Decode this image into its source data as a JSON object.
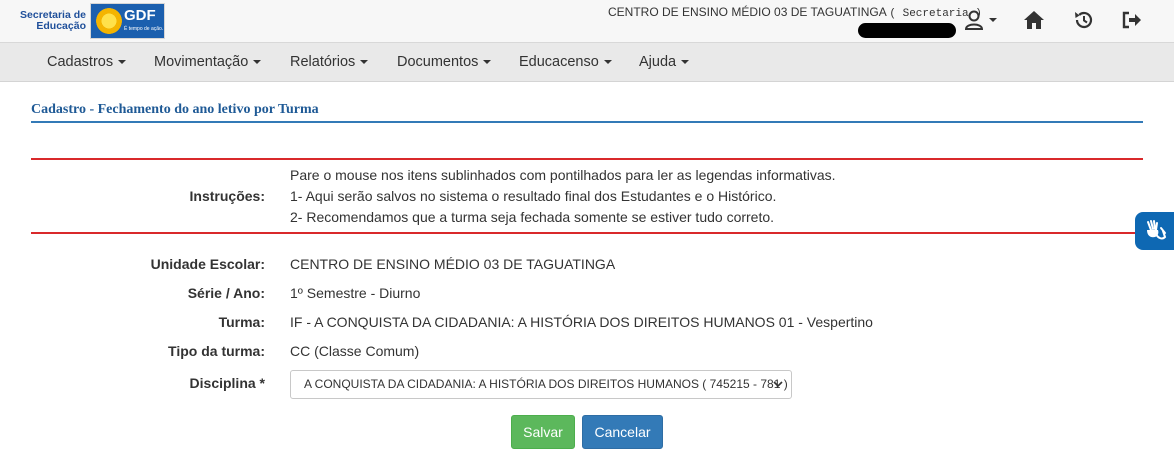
{
  "header": {
    "logo_secretaria": "Secretaria de Educação",
    "logo_gdf": "GDF",
    "logo_gdf_sub": "É tempo de ação.",
    "school_name": "CENTRO DE ENSINO MÉDIO 03 DE TAGUATINGA",
    "role": "( Secretaria )",
    "icons": [
      "user-icon",
      "home-icon",
      "history-icon",
      "sign-out-icon"
    ]
  },
  "nav": {
    "items": [
      "Cadastros",
      "Movimentação",
      "Relatórios",
      "Documentos",
      "Educacenso",
      "Ajuda"
    ]
  },
  "page": {
    "title": "Cadastro - Fechamento do ano letivo por Turma"
  },
  "instructions": {
    "label": "Instruções:",
    "lines": [
      "Pare o mouse nos itens sublinhados com pontilhados para ler as legendas informativas.",
      "1- Aqui serão salvos no sistema o resultado final dos Estudantes e o Histórico.",
      "2- Recomendamos que a turma seja fechada somente se estiver tudo correto."
    ]
  },
  "form": {
    "unidade_label": "Unidade Escolar:",
    "unidade_value": "CENTRO DE ENSINO MÉDIO 03 DE TAGUATINGA",
    "serie_label": "Série / Ano:",
    "serie_value": "1º Semestre - Diurno",
    "turma_label": "Turma:",
    "turma_value": "IF - A CONQUISTA DA CIDADANIA: A HISTÓRIA DOS DIREITOS HUMANOS 01 - Vespertino",
    "tipo_label": "Tipo da turma:",
    "tipo_value": "CC (Classe Comum)",
    "disciplina_label": "Disciplina *",
    "disciplina_selected": "A CONQUISTA DA CIDADANIA: A HISTÓRIA DOS DIREITOS HUMANOS ( 745215 - 781 )"
  },
  "buttons": {
    "save": "Salvar",
    "cancel": "Cancelar"
  },
  "colors": {
    "title": "#1f5a96",
    "rule_blue": "#337ab7",
    "rule_red": "#d9292b",
    "save": "#5cb85c",
    "cancel": "#337ab7",
    "vlibras": "#0e68b3"
  }
}
